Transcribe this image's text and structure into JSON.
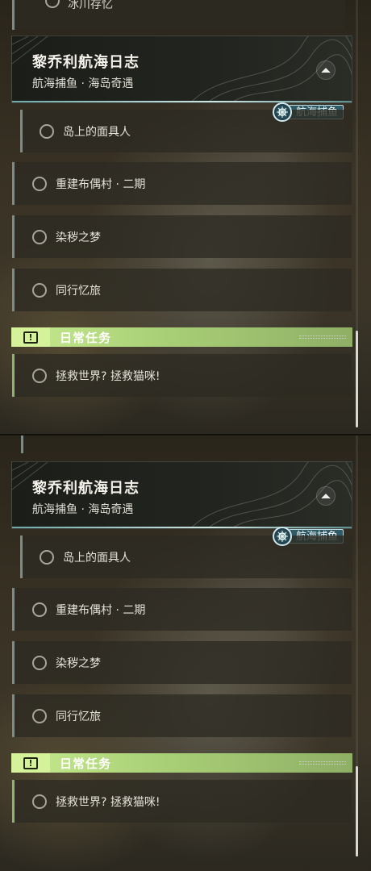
{
  "colors": {
    "accent_daily": "#c6ea8f",
    "tag_background": "#2f5a66",
    "item_border": "#7c8b86"
  },
  "top_panel": {
    "partial_item_label": "冰川存忆",
    "quest": {
      "title": "黎乔利航海日志",
      "subtitle": "航海捕鱼 · 海岛奇遇",
      "tag": "航海捕鱼",
      "tag_icon": "ship-wheel-icon",
      "collapse_icon": "chevron-up-icon"
    },
    "items": [
      {
        "label": "岛上的面具人"
      },
      {
        "label": "重建布偶村 · 二期"
      },
      {
        "label": "染秽之梦"
      },
      {
        "label": "同行忆旅"
      }
    ],
    "section": {
      "label": "日常任务",
      "icon": "exclamation-icon"
    },
    "daily_items": [
      {
        "label": "拯救世界? 拯救猫咪!"
      }
    ]
  },
  "bottom_panel": {
    "quest": {
      "title": "黎乔利航海日志",
      "subtitle": "航海捕鱼 · 海岛奇遇",
      "tag": "航海捕鱼",
      "tag_icon": "ship-wheel-icon",
      "collapse_icon": "chevron-up-icon"
    },
    "items": [
      {
        "label": "岛上的面具人"
      },
      {
        "label": "重建布偶村 · 二期"
      },
      {
        "label": "染秽之梦"
      },
      {
        "label": "同行忆旅"
      }
    ],
    "section": {
      "label": "日常任务",
      "icon": "exclamation-icon"
    },
    "daily_items": [
      {
        "label": "拯救世界? 拯救猫咪!"
      }
    ]
  }
}
